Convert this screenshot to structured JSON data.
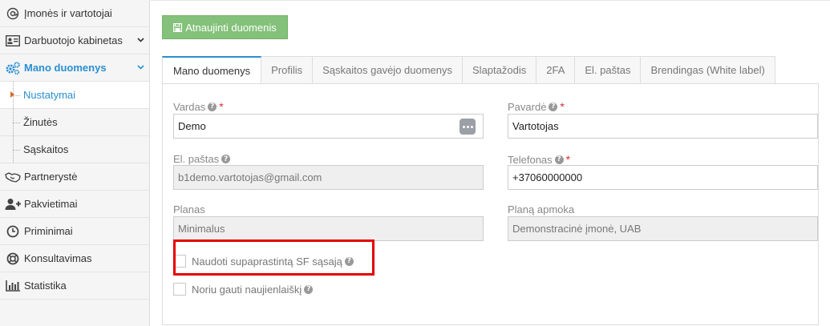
{
  "sidebar": {
    "items": [
      {
        "label": "Įmonės ir vartotojai",
        "icon": "at-sign-icon"
      },
      {
        "label": "Darbuotojo kabinetas",
        "icon": "id-card-icon"
      },
      {
        "label": "Mano duomenys",
        "icon": "gears-icon"
      },
      {
        "label": "Partnerystė",
        "icon": "handshake-icon"
      },
      {
        "label": "Pakvietimai",
        "icon": "user-plus-icon"
      },
      {
        "label": "Priminimai",
        "icon": "clock-icon"
      },
      {
        "label": "Konsultavimas",
        "icon": "life-ring-icon"
      },
      {
        "label": "Statistika",
        "icon": "bar-chart-icon"
      }
    ],
    "subitems": [
      {
        "label": "Nustatymai"
      },
      {
        "label": "Žinutės"
      },
      {
        "label": "Sąskaitos"
      }
    ]
  },
  "toolbar": {
    "update_label": "Atnaujinti duomenis"
  },
  "tabs": [
    {
      "label": "Mano duomenys"
    },
    {
      "label": "Profilis"
    },
    {
      "label": "Sąskaitos gavėjo duomenys"
    },
    {
      "label": "Slaptažodis"
    },
    {
      "label": "2FA"
    },
    {
      "label": "El. paštas"
    },
    {
      "label": "Brendingas (White label)"
    }
  ],
  "form": {
    "first_name": {
      "label": "Vardas",
      "value": "Demo"
    },
    "last_name": {
      "label": "Pavardė",
      "value": "Vartotojas"
    },
    "email": {
      "label": "El. paštas",
      "value": "b1demo.vartotojas@gmail.com"
    },
    "phone": {
      "label": "Telefonas",
      "value": "+37060000000"
    },
    "plan": {
      "label": "Planas",
      "value": "Minimalus"
    },
    "plan_payer": {
      "label": "Planą apmoka",
      "value": "Demonstracinė įmonė, UAB"
    },
    "simplified_invoice": {
      "label": "Naudoti supaprastintą SF sąsają",
      "checked": false
    },
    "newsletter": {
      "label": "Noriu gauti naujienlaiškį",
      "checked": false
    },
    "help_glyph": "?",
    "required_mark": "*"
  },
  "colors": {
    "accent": "#2a8fd1",
    "button_green": "#84c17a",
    "highlight_red": "#e60000"
  }
}
